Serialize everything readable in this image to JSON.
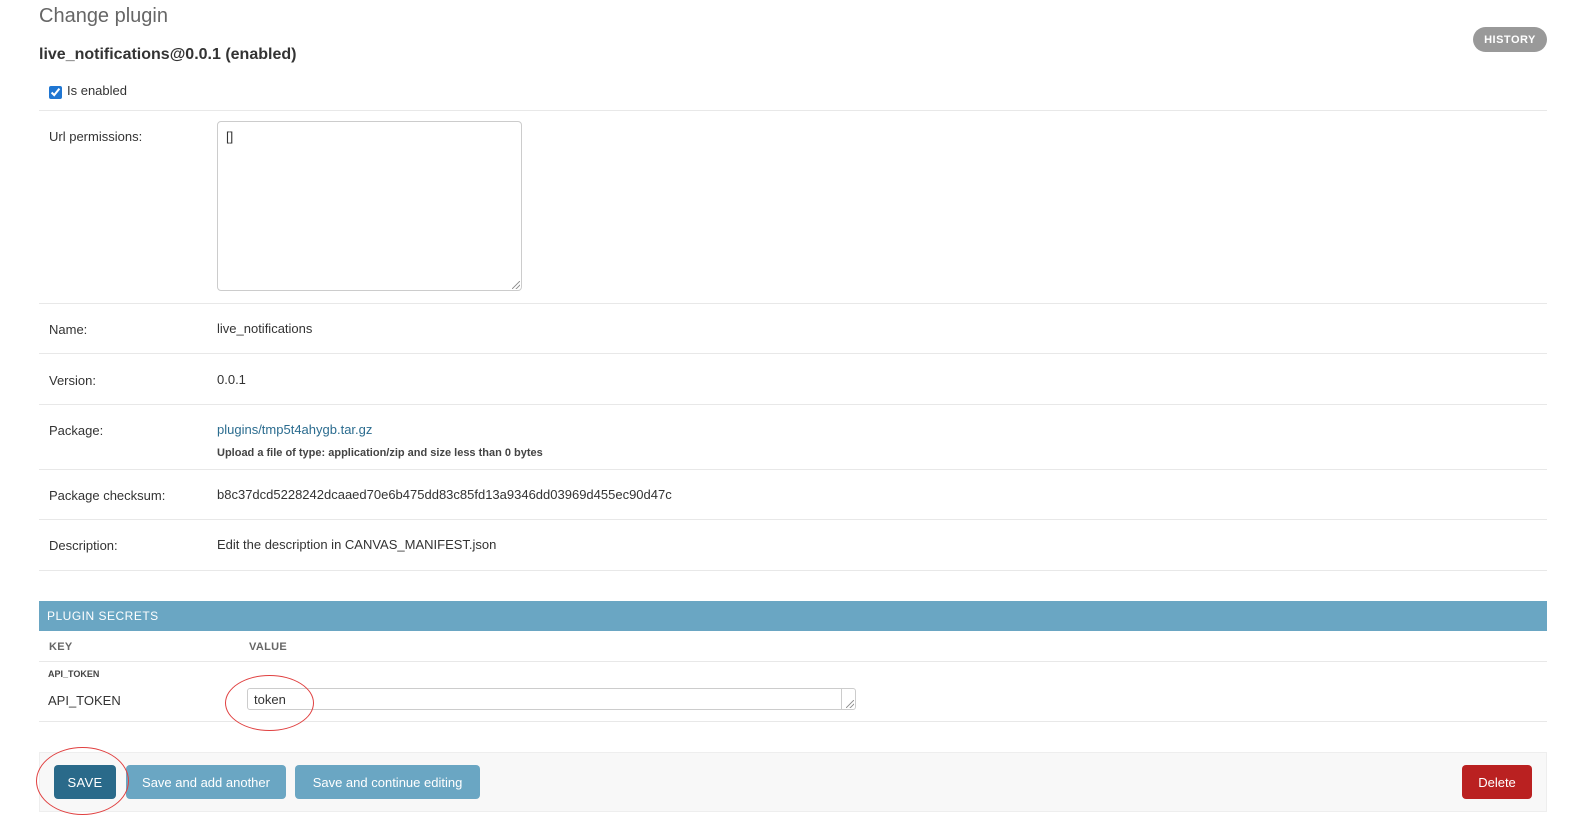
{
  "page": {
    "title": "Change plugin",
    "history_label": "HISTORY",
    "object_title": "live_notifications@0.0.1 (enabled)"
  },
  "form": {
    "is_enabled_label": "Is enabled",
    "is_enabled_checked": true,
    "url_permissions_label": "Url permissions:",
    "url_permissions_value": "[]",
    "name_label": "Name:",
    "name_value": "live_notifications",
    "version_label": "Version:",
    "version_value": "0.0.1",
    "package_label": "Package:",
    "package_value": "plugins/tmp5t4ahygb.tar.gz",
    "package_help": "Upload a file of type: application/zip and size less than 0 bytes",
    "checksum_label": "Package checksum:",
    "checksum_value": "b8c37dcd5228242dcaaed70e6b475dd83c85fd13a9346dd03969d455ec90d47c",
    "description_label": "Description:",
    "description_value": "Edit the description in CANVAS_MANIFEST.json"
  },
  "secrets": {
    "header": "PLUGIN SECRETS",
    "key_column": "KEY",
    "value_column": "VALUE",
    "rows": [
      {
        "small_label": "API_TOKEN",
        "key": "API_TOKEN",
        "value": "token"
      }
    ]
  },
  "actions": {
    "save": "SAVE",
    "save_add_another": "Save and add another",
    "save_continue": "Save and continue editing",
    "delete": "Delete"
  },
  "colors": {
    "header_blue": "#6aa6c3",
    "save_blue": "#2a6a8a",
    "delete_red": "#ba2121",
    "annotation_red": "#e04040"
  }
}
